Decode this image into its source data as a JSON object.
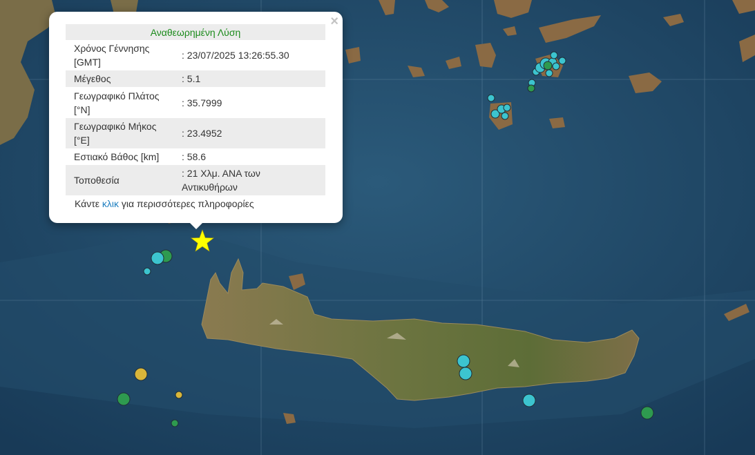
{
  "colors": {
    "sea_deep": "#183a57",
    "sea_shallow": "#2b5a7a",
    "land": "#8c7a52",
    "land_green": "#5e6e38",
    "epicenter_star": "#ffff00",
    "marker_cyan": "#3cc4cf",
    "marker_green": "#2e9a4f",
    "marker_yellow": "#d9b63a",
    "popup_header_text": "#1a8a1a",
    "link": "#1e7fc0"
  },
  "popup": {
    "close_symbol": "×",
    "header": "Αναθεωρημένη Λύση",
    "rows": [
      {
        "label": "Χρόνος Γέννησης [GMT]",
        "value": ": 23/07/2025 13:26:55.30"
      },
      {
        "label": "Μέγεθος",
        "value": ": 5.1"
      },
      {
        "label": "Γεωγραφικό Πλάτος [°N]",
        "value": ": 35.7999"
      },
      {
        "label": "Γεωγραφικό Μήκος [°E]",
        "value": ": 23.4952"
      },
      {
        "label": "Εστιακό Βάθος [km]",
        "value": ": 58.6"
      },
      {
        "label": "Τοποθεσία",
        "value": ": 21 Χλμ. ΑΝΑ των Αντικυθήρων"
      }
    ],
    "more_prefix": "Κάντε ",
    "more_link": "κλικ",
    "more_suffix": " για περισσότερες πληροφορίες"
  },
  "map": {
    "markers_icon": "earthquake-circle-icon",
    "epicenter_icon": "star-icon"
  }
}
